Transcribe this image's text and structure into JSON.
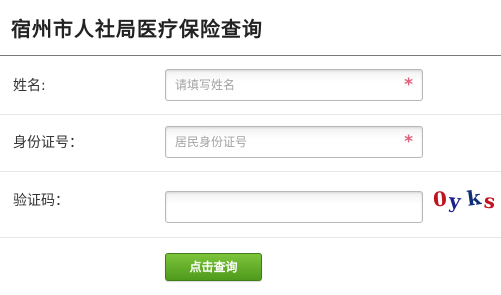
{
  "header": {
    "title": "宿州市人社局医疗保险查询"
  },
  "form": {
    "name": {
      "label": "姓名:",
      "placeholder": "请填写姓名",
      "value": "",
      "required_mark": "*"
    },
    "id_number": {
      "label": "身份证号：",
      "placeholder": "居民身份证号",
      "value": "",
      "required_mark": "*"
    },
    "captcha": {
      "label": "验证码：",
      "placeholder": "",
      "value": "",
      "image_text": [
        "0",
        "y",
        "k",
        "s"
      ]
    },
    "submit_label": "点击查询"
  },
  "colors": {
    "required": "#e0607a",
    "button_green": "#5aa624",
    "captcha_red": "#c0141f",
    "captcha_blue": "#1c1f8c"
  }
}
